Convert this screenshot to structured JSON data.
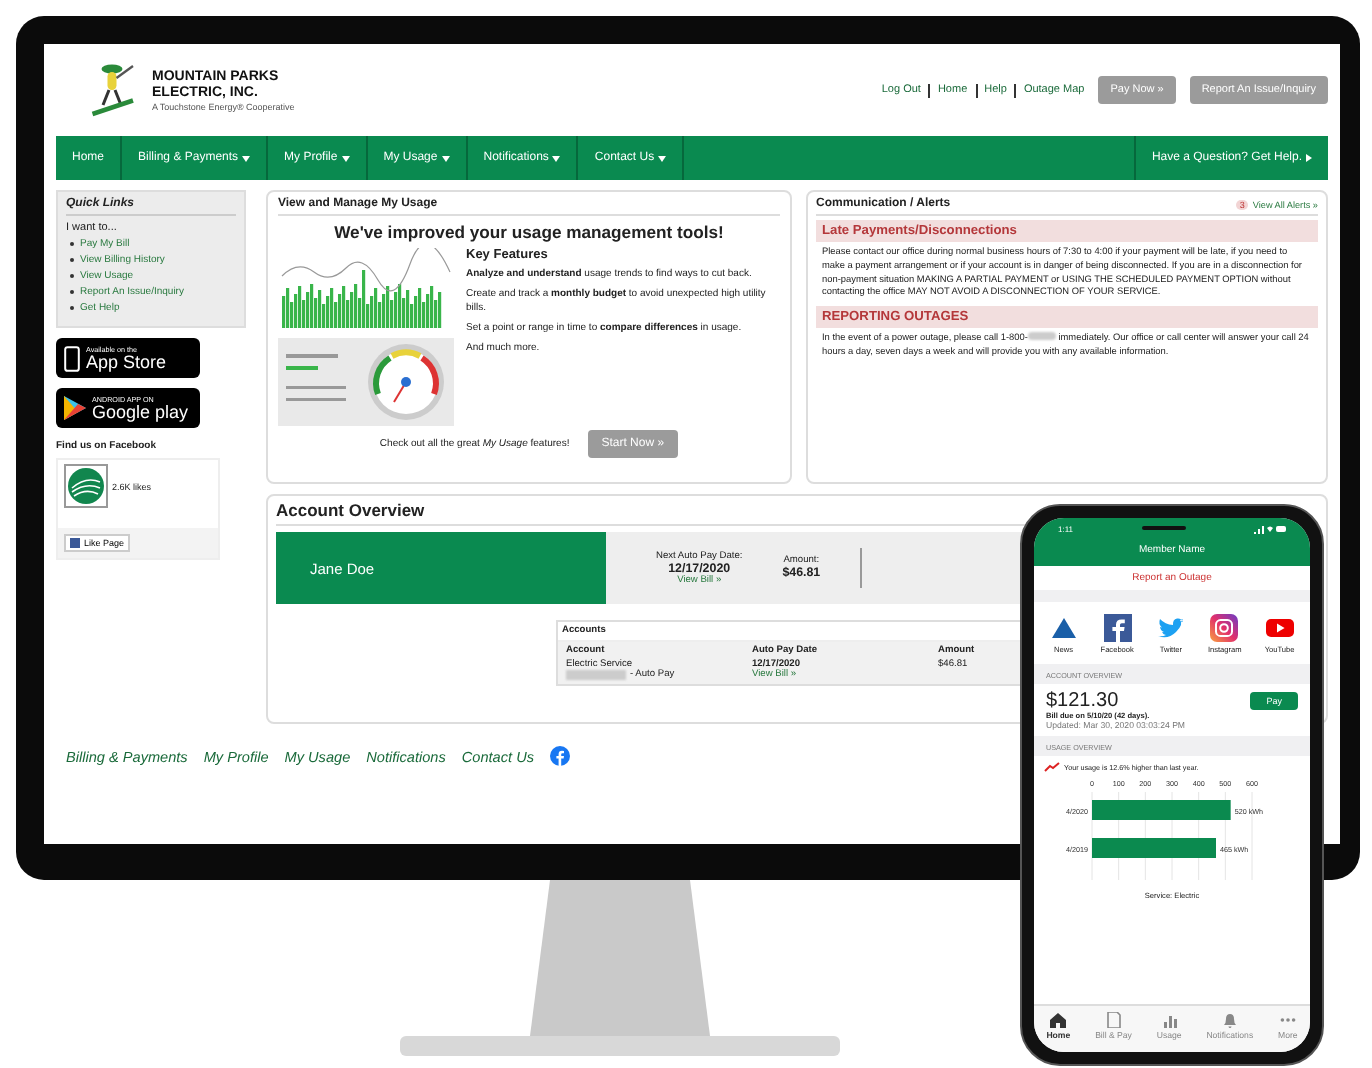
{
  "logo": {
    "line1": "MOUNTAIN PARKS",
    "line2": "ELECTRIC, INC.",
    "tagline": "A Touchstone Energy® Cooperative"
  },
  "top_links": [
    "Log Out",
    "Home",
    "Help",
    "Outage Map"
  ],
  "top_buttons": [
    "Pay Now »",
    "Report An Issue/Inquiry"
  ],
  "nav": {
    "items": [
      {
        "label": "Home",
        "dropdown": false
      },
      {
        "label": "Billing & Payments",
        "dropdown": true
      },
      {
        "label": "My Profile",
        "dropdown": true
      },
      {
        "label": "My Usage",
        "dropdown": true
      },
      {
        "label": "Notifications",
        "dropdown": true
      },
      {
        "label": "Contact Us",
        "dropdown": true
      }
    ],
    "help": "Have a Question? Get Help."
  },
  "quick_links": {
    "title": "Quick Links",
    "prompt": "I want to...",
    "items": [
      "Pay My Bill",
      "View Billing History",
      "View Usage",
      "Report An Issue/Inquiry",
      "Get Help"
    ]
  },
  "app_badges": [
    {
      "kind": "apple",
      "small": "Available on the",
      "big": "App Store"
    },
    {
      "kind": "google",
      "small": "ANDROID APP ON",
      "big": "Google play"
    }
  ],
  "facebook": {
    "title": "Find us on Facebook",
    "likes": "2.6K likes",
    "button": "Like Page"
  },
  "usage": {
    "title": "View and Manage My Usage",
    "headline": "We've improved your usage management tools!",
    "features_title": "Key Features",
    "features": [
      "**Analyze and understand** usage trends to find ways to cut back.",
      "Create and track a **monthly budget** to avoid unexpected high utility bills.",
      "Set a point or range in time to **compare differences** in usage.",
      "And much more."
    ],
    "cta": "Check out all the great *My Usage* features!",
    "button": "Start Now »"
  },
  "alerts": {
    "title": "Communication / Alerts",
    "count": "3",
    "view_all": "View All Alerts »",
    "sections": [
      {
        "kind": "plain",
        "heading": "Late Payments/Disconnections",
        "text": "Please contact our office during normal business hours of 7:30 to 4:00 if your payment will be late, if you need to make a payment arrangement or if your account is in danger of being disconnected. If you are in a disconnection for non-payment situation MAKING A PARTIAL PAYMENT or USING THE SCHEDULED PAYMENT OPTION without contacting the office MAY NOT AVOID A DISCONNECTION OF YOUR SERVICE."
      },
      {
        "kind": "redacted",
        "heading": "REPORTING OUTAGES",
        "text_start": "In the event of a power outage, please call 1-800-",
        "text_end": "immediately. Our office or call center will answer your call 24 hours a day, seven days a week and will provide you with any available information."
      }
    ]
  },
  "account_overview": {
    "title": "Account Overview",
    "name": "Jane Doe",
    "next_label": "Next Auto Pay Date:",
    "next_date": "12/17/2020",
    "view_bill": "View Bill »",
    "amount_label": "Amount:",
    "amount": "$46.81",
    "accounts": {
      "title": "Accounts",
      "columns": [
        "Account",
        "Auto Pay Date",
        "Amount"
      ],
      "rows": [
        {
          "account": "Electric Service",
          "suffix": "- Auto Pay",
          "date": "12/17/2020",
          "link": "View Bill »",
          "amount": "$46.81"
        }
      ]
    }
  },
  "footer_links": [
    "Billing & Payments",
    "My Profile",
    "My Usage",
    "Notifications",
    "Contact Us"
  ],
  "phone": {
    "time": "1:11",
    "header": "Member Name",
    "outage": "Report an Outage",
    "social": [
      {
        "kind": "news",
        "label": "News"
      },
      {
        "kind": "facebook",
        "label": "Facebook"
      },
      {
        "kind": "twitter",
        "label": "Twitter"
      },
      {
        "kind": "instagram",
        "label": "Instagram"
      },
      {
        "kind": "youtube",
        "label": "YouTube"
      }
    ],
    "account_heading": "ACCOUNT OVERVIEW",
    "balance": "$121.30",
    "pay": "Pay",
    "due": "Bill due on 5/10/20 (42 days).",
    "updated": "Updated: Mar 30, 2020 03:03:24 PM",
    "usage_heading": "USAGE OVERVIEW",
    "trend": "Your usage is 12.6% higher than last year.",
    "chart_data": {
      "type": "bar",
      "orientation": "horizontal",
      "categories": [
        "4/2020",
        "4/2019"
      ],
      "series": [
        {
          "color": "#0b8a4f",
          "values": [
            520,
            465
          ]
        }
      ],
      "grid": true,
      "xlim": [
        0,
        600
      ],
      "xticks": [
        0,
        100,
        200,
        300,
        400,
        500,
        600
      ],
      "value_labels": [
        "520 kWh",
        "465 kWh"
      ]
    },
    "service": "Service: Electric",
    "tabs": [
      {
        "kind": "home",
        "label": "Home",
        "selected": true
      },
      {
        "kind": "bill",
        "label": "Bill & Pay",
        "selected": false
      },
      {
        "kind": "usage",
        "label": "Usage",
        "selected": false
      },
      {
        "kind": "bell",
        "label": "Notifications",
        "selected": false
      },
      {
        "kind": "more",
        "label": "More",
        "selected": false
      }
    ]
  }
}
